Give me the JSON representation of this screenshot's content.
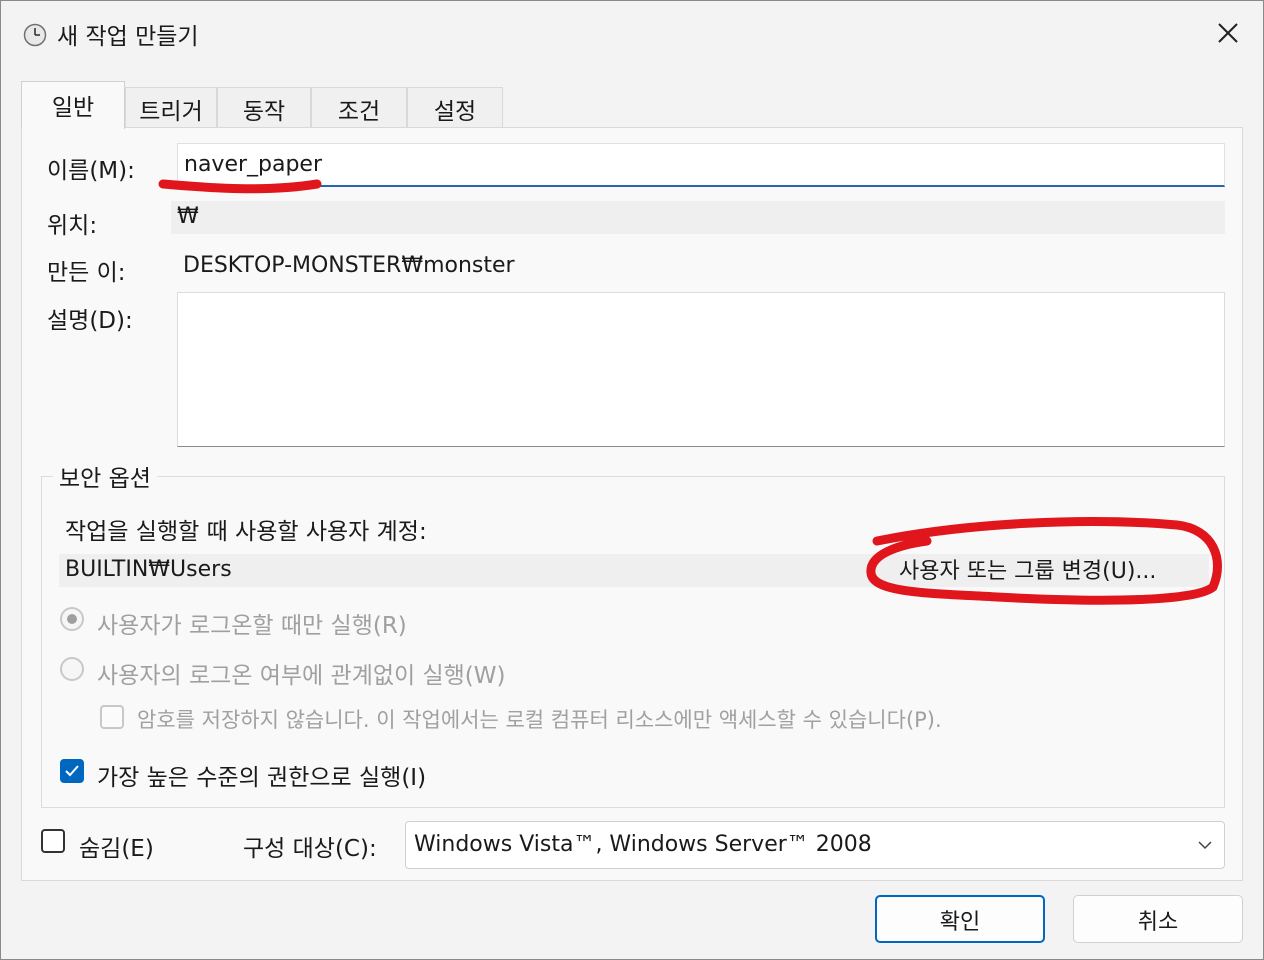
{
  "window": {
    "title": "새 작업 만들기"
  },
  "tabs": [
    "일반",
    "트리거",
    "동작",
    "조건",
    "설정"
  ],
  "general": {
    "name_label": "이름(M):",
    "name_value": "naver_paper",
    "location_label": "위치:",
    "location_value": "₩",
    "author_label": "만든 이:",
    "author_value": "DESKTOP-MONSTER₩monster",
    "description_label": "설명(D):"
  },
  "security": {
    "title": "보안 옵션",
    "account_prompt": "작업을 실행할 때 사용할 사용자 계정:",
    "account_value": "BUILTIN₩Users",
    "change_button": "사용자 또는 그룹 변경(U)...",
    "radio_logged_on": "사용자가 로그온할 때만 실행(R)",
    "radio_any": "사용자의 로그온 여부에 관계없이 실행(W)",
    "no_store_password": "암호를 저장하지 않습니다. 이 작업에서는 로컬 컴퓨터 리소스에만 액세스할 수 있습니다(P).",
    "highest_privileges": "가장 높은 수준의 권한으로 실행(I)"
  },
  "bottom": {
    "hidden_label": "숨김(E)",
    "configure_label": "구성 대상(C):",
    "configure_value": "Windows Vista™, Windows Server™ 2008",
    "ok": "확인",
    "cancel": "취소"
  },
  "state": {
    "radio_logged_on_selected": true,
    "highest_privileges_checked": true,
    "hidden_checked": false,
    "no_store_password_checked": false
  },
  "colors": {
    "accent": "#0067c0",
    "annotation": "#e0161c"
  }
}
